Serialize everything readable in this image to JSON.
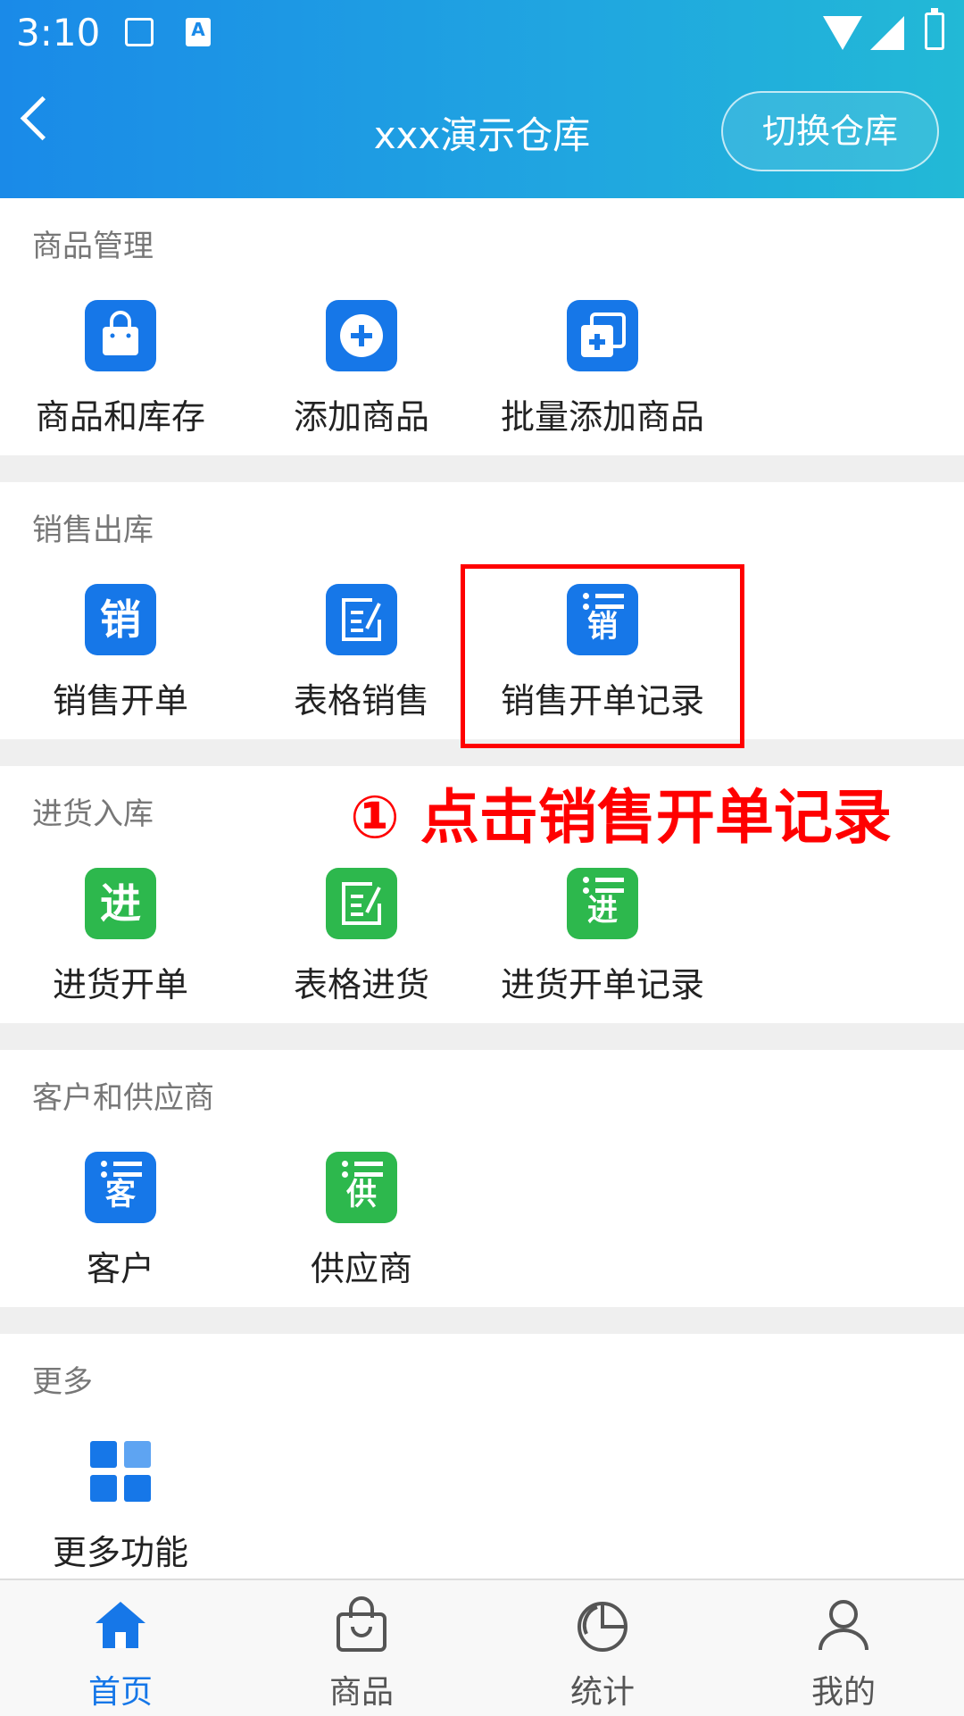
{
  "status_bar": {
    "time": "3:10",
    "accent": "#1a8ae8"
  },
  "header": {
    "title": "xxx演示仓库",
    "switch_label": "切换仓库"
  },
  "sections": [
    {
      "title": "商品管理",
      "items": [
        {
          "label": "商品和库存",
          "icon": "shopping-bag-icon",
          "color": "#1677e8"
        },
        {
          "label": "添加商品",
          "icon": "plus-circle-icon",
          "color": "#1677e8"
        },
        {
          "label": "批量添加商品",
          "icon": "batch-add-icon",
          "color": "#1677e8"
        }
      ]
    },
    {
      "title": "销售出库",
      "items": [
        {
          "label": "销售开单",
          "icon": "sales-order-icon",
          "glyph": "销",
          "color": "#1677e8"
        },
        {
          "label": "表格销售",
          "icon": "table-edit-icon",
          "color": "#1677e8"
        },
        {
          "label": "销售开单记录",
          "icon": "sales-record-icon",
          "glyph": "销",
          "color": "#1677e8"
        }
      ]
    },
    {
      "title": "进货入库",
      "items": [
        {
          "label": "进货开单",
          "icon": "purchase-order-icon",
          "glyph": "进",
          "color": "#2db84d"
        },
        {
          "label": "表格进货",
          "icon": "table-edit-icon",
          "color": "#2db84d"
        },
        {
          "label": "进货开单记录",
          "icon": "purchase-record-icon",
          "glyph": "进",
          "color": "#2db84d"
        }
      ]
    },
    {
      "title": "客户和供应商",
      "items": [
        {
          "label": "客户",
          "icon": "customer-list-icon",
          "glyph": "客",
          "color": "#1677e8"
        },
        {
          "label": "供应商",
          "icon": "supplier-list-icon",
          "glyph": "供",
          "color": "#2db84d"
        }
      ]
    },
    {
      "title": "更多",
      "items": [
        {
          "label": "更多功能",
          "icon": "grid-icon",
          "color": "#1677e8"
        }
      ]
    }
  ],
  "annotation": {
    "text": "① 点击销售开单记录",
    "color": "#ff0000"
  },
  "tabbar": [
    {
      "label": "首页",
      "icon": "home-icon",
      "active": true
    },
    {
      "label": "商品",
      "icon": "bag-icon",
      "active": false
    },
    {
      "label": "统计",
      "icon": "pie-chart-icon",
      "active": false
    },
    {
      "label": "我的",
      "icon": "user-icon",
      "active": false
    }
  ]
}
